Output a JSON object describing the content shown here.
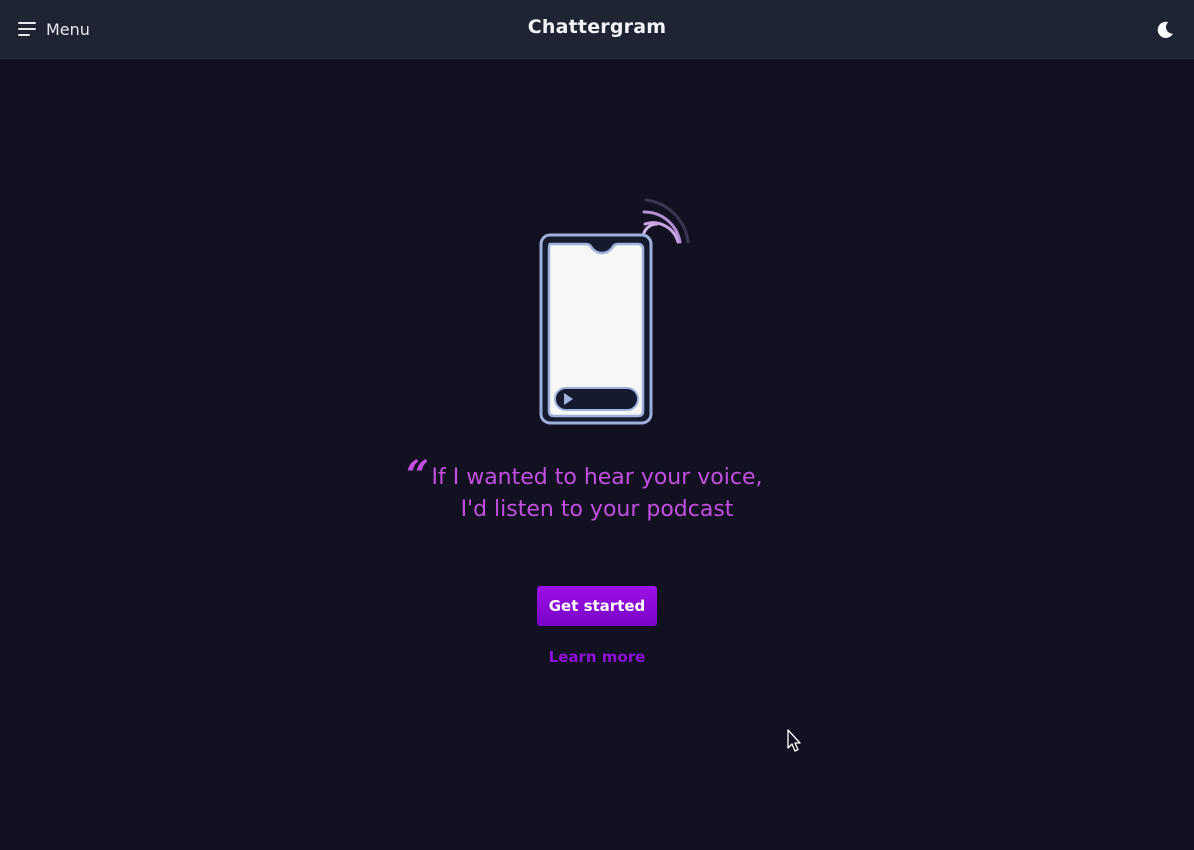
{
  "header": {
    "menu_label": "Menu",
    "app_title": "Chattergram",
    "menu_icon": "hamburger-icon",
    "theme_icon": "moon-icon"
  },
  "hero": {
    "illustration": "phone-podcast-illustration",
    "quote_lines": [
      "If I wanted to hear your voice,",
      "I'd listen to your podcast"
    ],
    "quote_mark": "“"
  },
  "actions": {
    "primary_label": "Get started",
    "secondary_label": "Learn more"
  },
  "colors": {
    "background": "#111122",
    "topbar": "#1f2432",
    "accent": "#c44ee0",
    "button": "#8a0ad8",
    "phone_outline": "#9fb0dc"
  }
}
